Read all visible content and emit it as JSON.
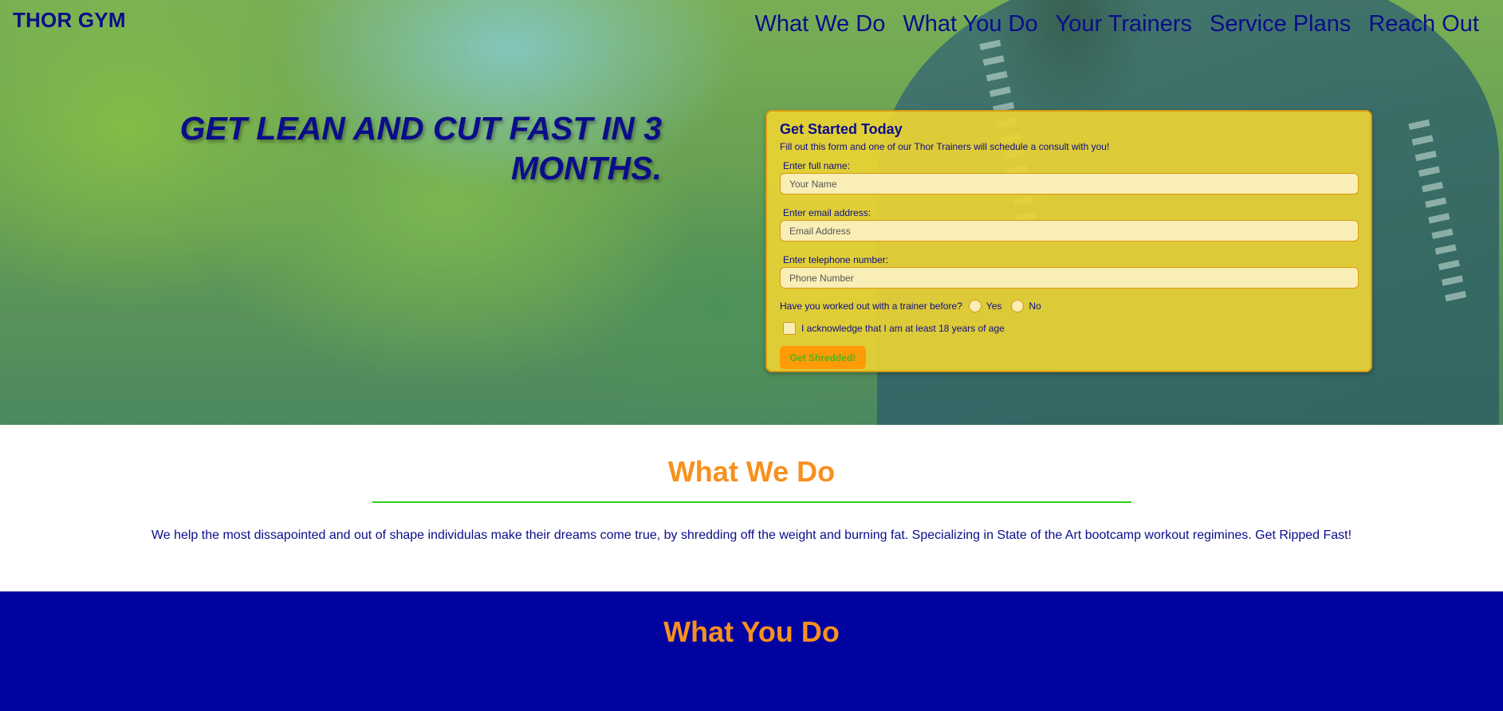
{
  "brand": "THOR GYM",
  "nav": [
    "What We Do",
    "What You Do",
    "Your Trainers",
    "Service Plans",
    "Reach Out"
  ],
  "hero": {
    "headline": "GET LEAN AND CUT FAST IN 3 MONTHS."
  },
  "form": {
    "title": "Get Started Today",
    "subtitle": "Fill out this form and one of our Thor Trainers will schedule a consult with you!",
    "name_label": "Enter full name:",
    "name_placeholder": "Your Name",
    "email_label": "Enter email address:",
    "email_placeholder": "Email Address",
    "phone_label": "Enter telephone number:",
    "phone_placeholder": "Phone Number",
    "trainer_question": "Have you worked out with a trainer before?",
    "yes_label": "Yes",
    "no_label": "No",
    "age_ack": "I acknowledge that I am at least 18 years of age",
    "submit_label": "Get Shredded!"
  },
  "what_we_do": {
    "title": "What We Do",
    "text": "We help the most dissapointed and out of shape individulas make their dreams come true, by shredding off the weight and burning fat. Specializing in State of the Art bootcamp workout regimines. Get Ripped Fast!"
  },
  "what_you_do": {
    "title": "What You Do"
  },
  "colors": {
    "navy": "#0b0d8a",
    "orange": "#f7901e",
    "green": "#2ed11a",
    "form_yellow": "#ecd234",
    "blue_section": "#0003a0"
  }
}
